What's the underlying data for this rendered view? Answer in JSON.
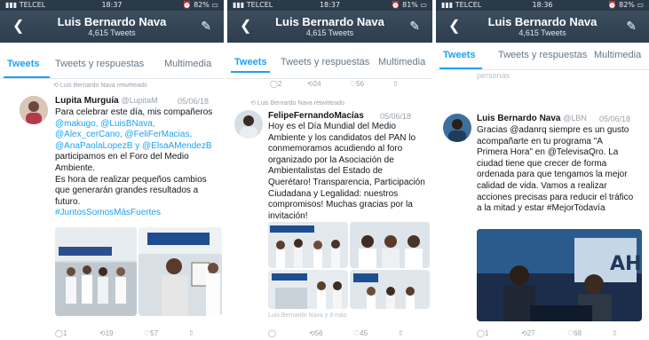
{
  "panels": [
    {
      "status": {
        "carrier": "TELCEL",
        "time": "18:37",
        "battery": "82%"
      },
      "header": {
        "name": "Luis Bernardo Nava",
        "count": "4,615 Tweets"
      },
      "tabs": [
        "Tweets",
        "Tweets y respuestas",
        "Multimedia"
      ],
      "retweet_note": "Luis Bernardo Nava retwitteado",
      "tweet": {
        "author": "Lupita Murguía",
        "handle": "@LupitaM",
        "date": "05/06/18",
        "lines": [
          "Para celebrar este día, mis compañeros",
          "@makugo, @LuisBNava,",
          "@Alex_cerCano, @FeliFerMacias,",
          "@AnaPaolaLopezB y @ElsaAMendezB",
          "participamos en el Foro del Medio",
          "Ambiente.",
          "Es hora de realizar pequeños cambios",
          "que generarán grandes resultados a",
          "futuro.",
          "#JuntosSomosMásFuertes"
        ],
        "counts": {
          "replies": "1",
          "retweets": "19",
          "likes": "57"
        }
      }
    },
    {
      "status": {
        "carrier": "TELCEL",
        "time": "18:37",
        "battery": "81%"
      },
      "header": {
        "name": "Luis Bernardo Nava",
        "count": "4,615 Tweets"
      },
      "tabs": [
        "Tweets",
        "Tweets y respuestas",
        "Multimedia"
      ],
      "top_counts": {
        "replies": "2",
        "retweets": "24",
        "likes": "56"
      },
      "retweet_note": "Luis Bernardo Nava retwitteado",
      "tweet": {
        "author": "FelipeFernandoMacías",
        "handle": "",
        "date": "05/06/18",
        "lines": [
          "Hoy es el Día Mundial del Medio",
          "Ambiente y los candidatos del PAN lo",
          "conmemoramos acudiendo al foro",
          "organizado por la Asociación de",
          "Ambientalistas del Estado de",
          "Querétaro! Transparencia, Participación",
          "Ciudadana y Legalidad: nuestros",
          "compromisos! Muchas gracias por la",
          "invitación!"
        ],
        "footer_note": "Luis Bernardo Nava y 9 más",
        "counts": {
          "replies": "",
          "retweets": "56",
          "likes": "45"
        }
      }
    },
    {
      "status": {
        "carrier": "TELCEL",
        "time": "18:36",
        "battery": "82%"
      },
      "header": {
        "name": "Luis Bernardo Nava",
        "count": "4,615 Tweets"
      },
      "tabs": [
        "Tweets",
        "Tweets y respuestas",
        "Multimedia"
      ],
      "fade_text": "personas",
      "tweet": {
        "author": "Luis Bernardo Nava",
        "handle": "@LBN",
        "date": "05/06/18",
        "lines": [
          "Gracias @adanrq siempre es un gusto",
          "acompañarte en tu programa \"A",
          "Primera Hora\" en @TelevisaQro. La",
          "ciudad tiene que crecer de forma",
          "ordenada para que tengamos la mejor",
          "calidad de vida. Vamos a realizar",
          "acciones precisas para reducir el tráfico",
          "a la mitad y estar #MejorTodavía"
        ],
        "counts": {
          "replies": "1",
          "retweets": "27",
          "likes": "68"
        }
      }
    }
  ],
  "colors": {
    "accent": "#1da1f2",
    "header": "#2d3d4d",
    "muted": "#98a3ad"
  }
}
